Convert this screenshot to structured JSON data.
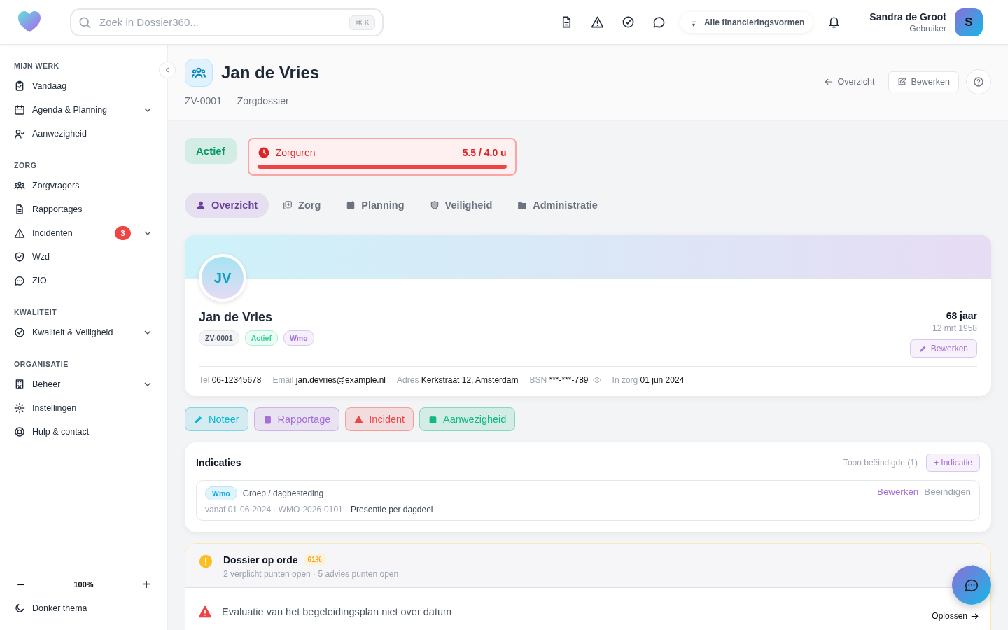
{
  "header": {
    "search": {
      "placeholder": "Zoek in Dossier360...",
      "shortcut": "⌘ K"
    },
    "filter": "Alle financieringsvormen",
    "user": {
      "name": "Sandra de Groot",
      "role": "Gebruiker",
      "initial": "S"
    }
  },
  "sidebar": {
    "sections": [
      {
        "title": "MIJN WERK",
        "items": [
          {
            "label": "Vandaag"
          },
          {
            "label": "Agenda & Planning",
            "expanded": false
          },
          {
            "label": "Aanwezigheid"
          }
        ]
      },
      {
        "title": "ZORG",
        "items": [
          {
            "label": "Zorgvragers"
          },
          {
            "label": "Rapportages"
          },
          {
            "label": "Incidenten",
            "badge": "3",
            "expanded": false
          },
          {
            "label": "Wzd"
          },
          {
            "label": "ZIO"
          }
        ]
      },
      {
        "title": "KWALITEIT",
        "items": [
          {
            "label": "Kwaliteit & Veiligheid",
            "expanded": false
          }
        ]
      },
      {
        "title": "ORGANISATIE",
        "items": [
          {
            "label": "Beheer",
            "expanded": false
          },
          {
            "label": "Instellingen"
          },
          {
            "label": "Hulp & contact"
          }
        ]
      }
    ],
    "zoom": {
      "minus": "−",
      "value": "100%",
      "plus": "+"
    },
    "theme": "Donker thema"
  },
  "page_header": {
    "title": "Jan de Vries",
    "subtitle": "ZV-0001 — Zorgdossier",
    "back": "Overzicht",
    "edit": "Bewerken"
  },
  "status": "Actief",
  "care_hours": {
    "label": "Zorguren",
    "reading": "5.5 / 4.0 u",
    "level": 1.0
  },
  "tabs": [
    {
      "label": "Overzicht",
      "selected": true
    },
    {
      "label": "Zorg",
      "selected": false
    },
    {
      "label": "Planning",
      "selected": false
    },
    {
      "label": "Veiligheid",
      "selected": false
    },
    {
      "label": "Administratie",
      "selected": false
    }
  ],
  "profile": {
    "initials": "JV",
    "name": "Jan de Vries",
    "tags": [
      {
        "label": "ZV-0001",
        "color": "#f3f4f6"
      },
      {
        "label": "Actief",
        "color": "#ecfdf5"
      },
      {
        "label": "Wmo",
        "color": "#f5f0fb"
      }
    ],
    "age": "68 jaar",
    "birthdate": "12 mrt 1958",
    "edit": "Bewerken",
    "details": [
      {
        "label": "Tel",
        "value": "06-12345678",
        "hidden": false
      },
      {
        "label": "Email",
        "value": "jan.devries@example.nl",
        "hidden": false
      },
      {
        "label": "Adres",
        "value": "Kerkstraat 12, Amsterdam",
        "hidden": false
      },
      {
        "label": "BSN",
        "value": "***-***-789",
        "hidden": true
      },
      {
        "label": "In zorg",
        "value": "01 jun 2024",
        "hidden": false
      }
    ]
  },
  "quick_actions": [
    {
      "label": "Noteer",
      "color": "#06b6d4"
    },
    {
      "label": "Rapportage",
      "color": "#a56fd6"
    },
    {
      "label": "Incident",
      "color": "#ef4444"
    },
    {
      "label": "Aanwezigheid",
      "color": "#10b981"
    }
  ],
  "indications": {
    "title": "Indicaties",
    "show_ended": "Toon beëindigde (1)",
    "add": "+ Indicatie",
    "items": [
      {
        "badge": "Wmo",
        "title": "Groep / dagbesteding",
        "meta": "vanaf 01-06-2024 · WMO-2026-0101 ·",
        "detail": "Presentie per dagdeel",
        "actions": [
          "Bewerken",
          "Beëindigen"
        ]
      }
    ]
  },
  "dossier_check": {
    "title": "Dossier op orde",
    "percentage": "61%",
    "summary": "2 verplicht punten open · 5 advies punten open",
    "expanded": true,
    "issues": [
      {
        "text": "Evaluatie van het begeleidingsplan niet over datum",
        "action": "Oplossen"
      }
    ]
  }
}
